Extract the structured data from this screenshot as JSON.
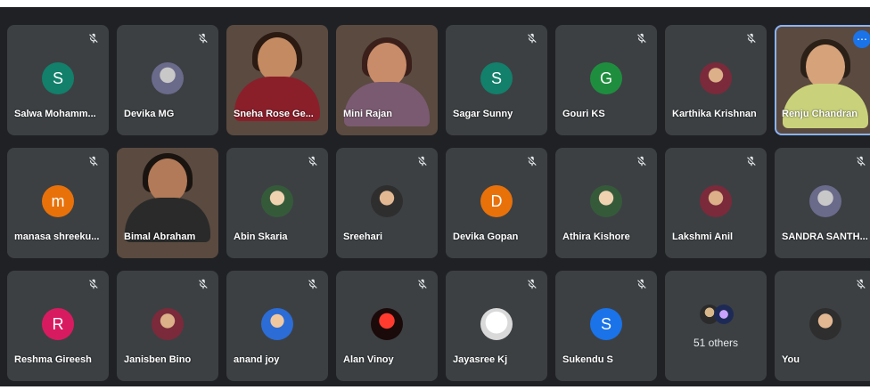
{
  "icons": {
    "mic_off": "mic-off-icon",
    "more": "more-options-icon"
  },
  "colors": {
    "stage_bg": "#202124",
    "tile_bg": "#3c4043",
    "highlight": "#8ab4f8",
    "more_button": "#1a73e8"
  },
  "participants": [
    {
      "name": "Salwa Mohamm...",
      "initial": "S",
      "avatar_color": "#12806b"
    },
    {
      "name": "Devika MG"
    },
    {
      "name": "Sneha Rose Ge..."
    },
    {
      "name": "Mini Rajan"
    },
    {
      "name": "Sagar Sunny",
      "initial": "S",
      "avatar_color": "#12806b"
    },
    {
      "name": "Gouri KS",
      "initial": "G",
      "avatar_color": "#1e8e3e"
    },
    {
      "name": "Karthika Krishnan"
    },
    {
      "name": "Renju Chandran"
    },
    {
      "name": "manasa shreeku...",
      "initial": "m",
      "avatar_color": "#e8710a"
    },
    {
      "name": "Bimal Abraham"
    },
    {
      "name": "Abin Skaria"
    },
    {
      "name": "Sreehari"
    },
    {
      "name": "Devika Gopan",
      "initial": "D",
      "avatar_color": "#e8710a"
    },
    {
      "name": "Athira Kishore"
    },
    {
      "name": "Lakshmi Anil"
    },
    {
      "name": "SANDRA SANTH..."
    },
    {
      "name": "Reshma Gireesh",
      "initial": "R",
      "avatar_color": "#d81b60"
    },
    {
      "name": "Janisben Bino"
    },
    {
      "name": "anand joy"
    },
    {
      "name": "Alan Vinoy"
    },
    {
      "name": "Jayasree Kj"
    },
    {
      "name": "Sukendu S",
      "initial": "S",
      "avatar_color": "#1a73e8"
    },
    {
      "name": "51 others"
    },
    {
      "name": "You"
    }
  ]
}
